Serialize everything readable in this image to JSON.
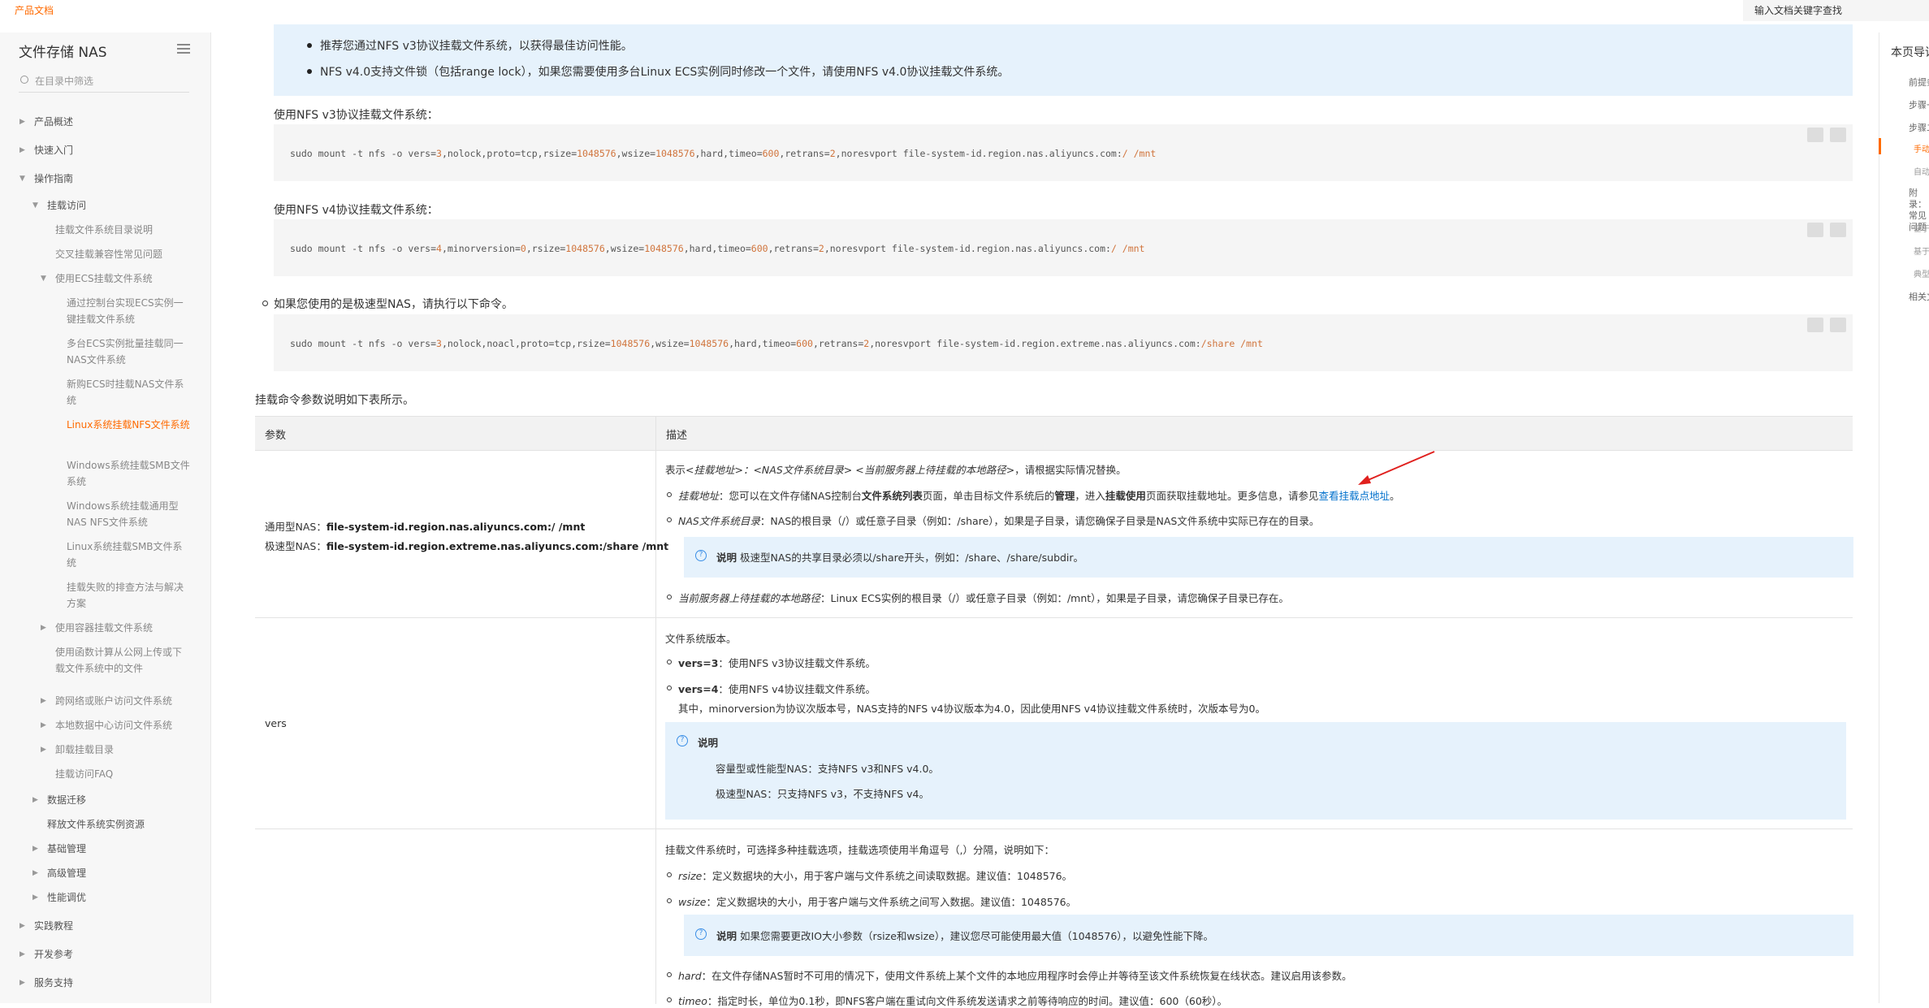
{
  "header": {
    "brand": "产品文档",
    "search_placeholder": "输入文档关键字查找"
  },
  "sidebar": {
    "title": "文件存储 NAS",
    "search_placeholder": "在目录中筛选",
    "items": [
      {
        "label": "产品概述"
      },
      {
        "label": "快速入门"
      },
      {
        "label": "操作指南"
      },
      {
        "label": "挂载访问"
      },
      {
        "label": "挂载文件系统目录说明"
      },
      {
        "label": "交叉挂载兼容性常见问题"
      },
      {
        "label": "使用ECS挂载文件系统"
      },
      {
        "label": "通过控制台实现ECS实例一键挂载文件系统"
      },
      {
        "label": "多台ECS实例批量挂载同一NAS文件系统"
      },
      {
        "label": "新购ECS时挂载NAS文件系统"
      },
      {
        "label": "Linux系统挂载NFS文件系统"
      },
      {
        "label": "Windows系统挂载SMB文件系统"
      },
      {
        "label": "Windows系统挂载通用型NAS NFS文件系统"
      },
      {
        "label": "Linux系统挂载SMB文件系统"
      },
      {
        "label": "挂载失败的排查方法与解决方案"
      },
      {
        "label": "使用容器挂载文件系统"
      },
      {
        "label": "使用函数计算从公网上传或下载文件系统中的文件"
      },
      {
        "label": "跨网络或账户访问文件系统"
      },
      {
        "label": "本地数据中心访问文件系统"
      },
      {
        "label": "卸载挂载目录"
      },
      {
        "label": "挂载访问FAQ"
      },
      {
        "label": "数据迁移"
      },
      {
        "label": "释放文件系统实例资源"
      },
      {
        "label": "基础管理"
      },
      {
        "label": "高级管理"
      },
      {
        "label": "性能调优"
      },
      {
        "label": "实践教程"
      },
      {
        "label": "开发参考"
      },
      {
        "label": "服务支持"
      }
    ]
  },
  "content": {
    "tip1": "推荐您通过NFS v3协议挂载文件系统，以获得最佳访问性能。",
    "tip2": "NFS v4.0支持文件锁（包括range lock），如果您需要使用多台Linux ECS实例同时修改一个文件，请使用NFS v4.0协议挂载文件系统。",
    "v3_label": "使用NFS v3协议挂载文件系统：",
    "v3_code_a": "sudo mount -t nfs -o vers=",
    "v3_code_b": "3",
    "v3_code_c": ",nolock,proto=tcp,rsize=",
    "v3_code_d": "1048576",
    "v3_code_e": ",wsize=",
    "v3_code_f": "1048576",
    "v3_code_g": ",hard,timeo=",
    "v3_code_h": "600",
    "v3_code_i": ",retrans=",
    "v3_code_j": "2",
    "v3_code_k": ",noresvport file-system-id.region.nas.aliyuncs.com:",
    "v3_code_l": "/ /mnt",
    "v4_label": "使用NFS v4协议挂载文件系统：",
    "v4_code_a": "sudo mount -t nfs -o vers=",
    "v4_code_b": "4",
    "v4_code_c": ",minorversion=",
    "v4_code_d": "0",
    "v4_code_e": ",rsize=",
    "v4_code_f": "1048576",
    "v4_code_g": ",wsize=",
    "v4_code_h": "1048576",
    "v4_code_i": ",hard,timeo=",
    "v4_code_j": "600",
    "v4_code_k": ",retrans=",
    "v4_code_l": "2",
    "v4_code_m": ",noresvport file-system-id.region.nas.aliyuncs.com:",
    "v4_code_n": "/ /mnt",
    "extreme_label": "如果您使用的是极速型NAS，请执行以下命令。",
    "ex_code_a": "sudo mount -t nfs -o vers=",
    "ex_code_b": "3",
    "ex_code_c": ",nolock,noacl,proto=tcp,rsize=",
    "ex_code_d": "1048576",
    "ex_code_e": ",wsize=",
    "ex_code_f": "1048576",
    "ex_code_g": ",hard,timeo=",
    "ex_code_h": "600",
    "ex_code_i": ",retrans=",
    "ex_code_j": "2",
    "ex_code_k": ",noresvport file-system-id.region.extreme.nas.aliyuncs.com:",
    "ex_code_l": "/share /mnt",
    "table_intro": "挂载命令参数说明如下表所示。"
  },
  "table": {
    "col_param": "参数",
    "col_desc": "描述",
    "row1": {
      "param_a_label": "通用型NAS：",
      "param_a_value": "file-system-id.region.nas.aliyuncs.com:/ /mnt",
      "param_b_label": "极速型NAS：",
      "param_b_value": "file-system-id.region.extreme.nas.aliyuncs.com:/share /mnt",
      "desc_intro_a": "表示",
      "desc_intro_b": "<挂载地址>：<NAS文件系统目录> <当前服务器上待挂载的本地路径>",
      "desc_intro_c": "，请根据实际情况替换。",
      "li1_a": "挂载地址",
      "li1_b": "：您可以在文件存储NAS控制台",
      "li1_c": "文件系统列表",
      "li1_d": "页面，单击目标文件系统后的",
      "li1_e": "管理",
      "li1_f": "，进入",
      "li1_g": "挂载使用",
      "li1_h": "页面获取挂载地址。更多信息，请参见",
      "li1_link": "查看挂载点地址",
      "li1_i": "。",
      "li2_a": "NAS文件系统目录",
      "li2_b": "：NAS的根目录（/）或任意子目录（例如：/share），如果是子目录，请您确保子目录是NAS文件系统中实际已存在的目录。",
      "note_label": "说明",
      "note_text": "极速型NAS的共享目录必须以/share开头，例如：/share、/share/subdir。",
      "li3_a": "当前服务器上待挂载的本地路径",
      "li3_b": "：Linux ECS实例的根目录（/）或任意子目录（例如：/mnt），如果是子目录，请您确保子目录已存在。"
    },
    "row2": {
      "param": "vers",
      "desc_intro": "文件系统版本。",
      "li1_a": "vers=3",
      "li1_b": "：使用NFS v3协议挂载文件系统。",
      "li2_a": "vers=4",
      "li2_b": "：使用NFS v4协议挂载文件系统。",
      "li2_extra": "其中，minorversion为协议次版本号，NAS支持的NFS v4协议版本为4.0，因此使用NFS v4协议挂载文件系统时，次版本号为0。",
      "note_label": "说明",
      "note_li1": "容量型或性能型NAS：支持NFS v3和NFS v4.0。",
      "note_li2": "极速型NAS：只支持NFS v3，不支持NFS v4。"
    },
    "row3": {
      "desc_intro": "挂载文件系统时，可选择多种挂载选项，挂载选项使用半角逗号（,）分隔，说明如下：",
      "li1_a": "rsize",
      "li1_b": "：定义数据块的大小，用于客户端与文件系统之间读取数据。建议值：1048576。",
      "li2_a": "wsize",
      "li2_b": "：定义数据块的大小，用于客户端与文件系统之间写入数据。建议值：1048576。",
      "note_label": "说明",
      "note_text": "如果您需要更改IO大小参数（rsize和wsize），建议您尽可能使用最大值（1048576），以避免性能下降。",
      "li3_a": "hard",
      "li3_b": "：在文件存储NAS暂时不可用的情况下，使用文件系统上某个文件的本地应用程序时会停止并等待至该文件系统恢复在线状态。建议启用该参数。",
      "li4_a": "timeo",
      "li4_b": "：指定时长，单位为0.1秒，即NFS客户端在重试向文件系统发送请求之前等待响应的时间。建议值：600（60秒）。"
    }
  },
  "toc": {
    "title": "本页导读",
    "items": [
      {
        "label": "前提条件"
      },
      {
        "label": "步骤一"
      },
      {
        "label": "步骤二"
      },
      {
        "label": "手动"
      },
      {
        "label": "自动"
      },
      {
        "label": "附录：常见问题"
      },
      {
        "label": "基于"
      },
      {
        "label": "基于"
      },
      {
        "label": "典型"
      },
      {
        "label": "相关文"
      }
    ]
  },
  "colors": {
    "accent": "#ff6a00",
    "link": "#0070cc",
    "note_bg": "#e6f2fc",
    "code_bg": "#f5f5f5",
    "arrow": "#e0201e"
  }
}
